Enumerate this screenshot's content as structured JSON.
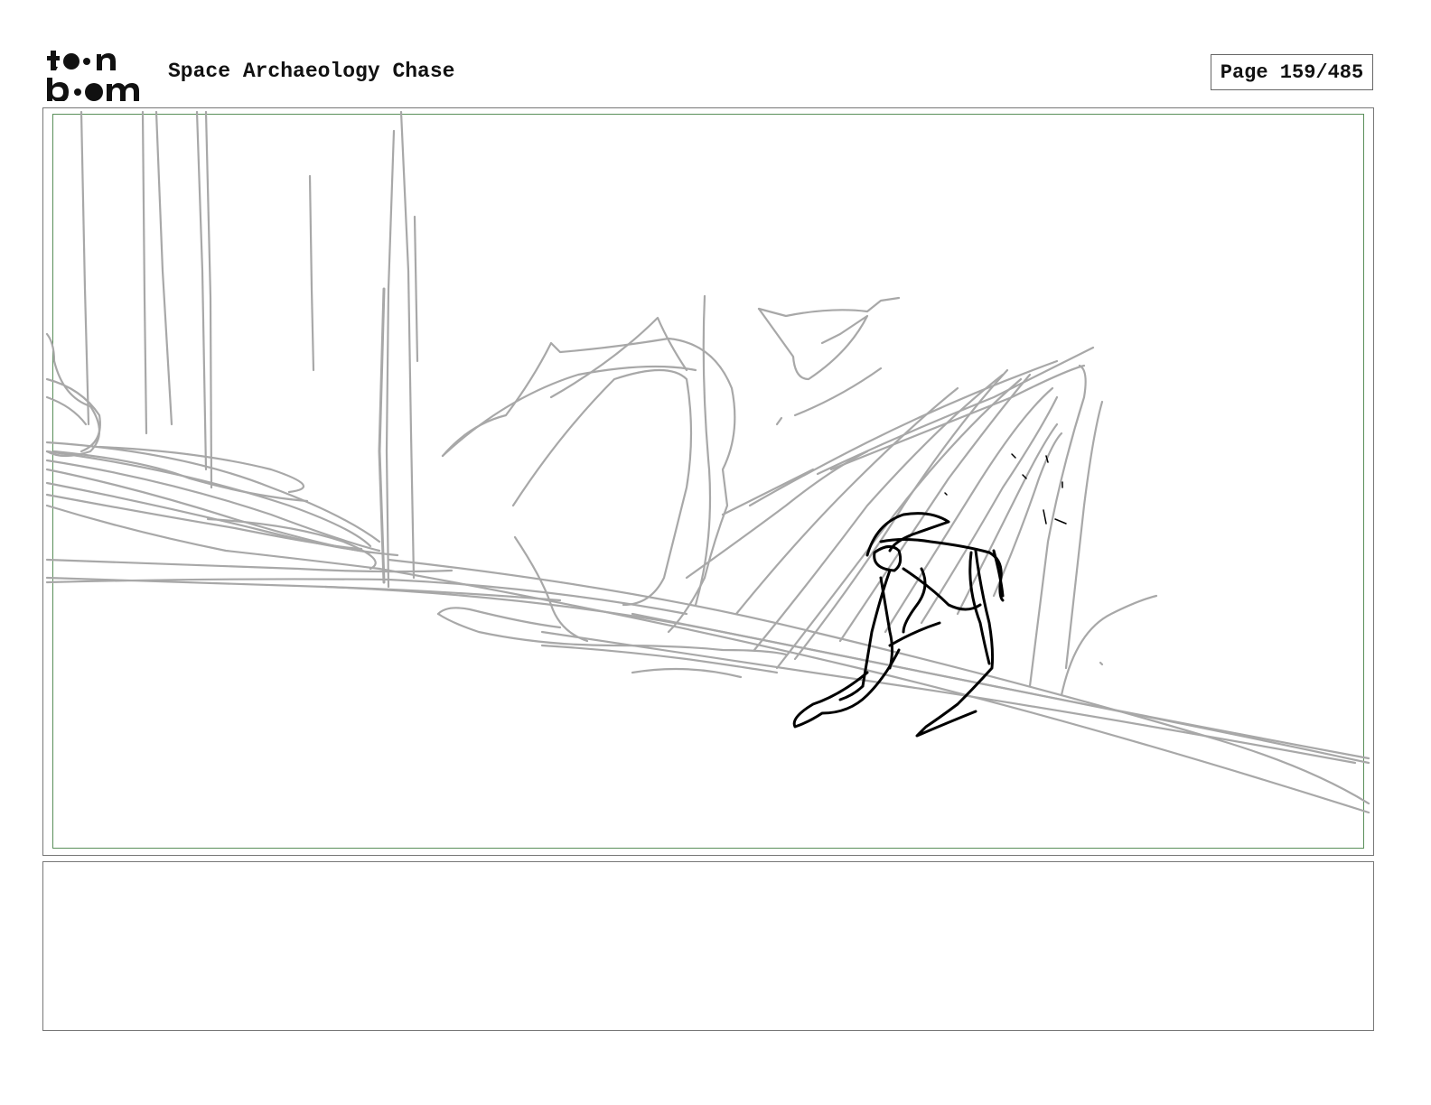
{
  "header": {
    "logo_text_top": "toon",
    "logo_text_bottom": "boom",
    "project_title": "Space Archaeology Chase",
    "page_label": "Page 159/485"
  },
  "panel": {
    "frame_color": "#777777",
    "safe_frame_color": "#5a8f5a",
    "sketch_rough_color": "#a8a8a8",
    "sketch_character_color": "#000000"
  },
  "notes": {
    "text": ""
  }
}
